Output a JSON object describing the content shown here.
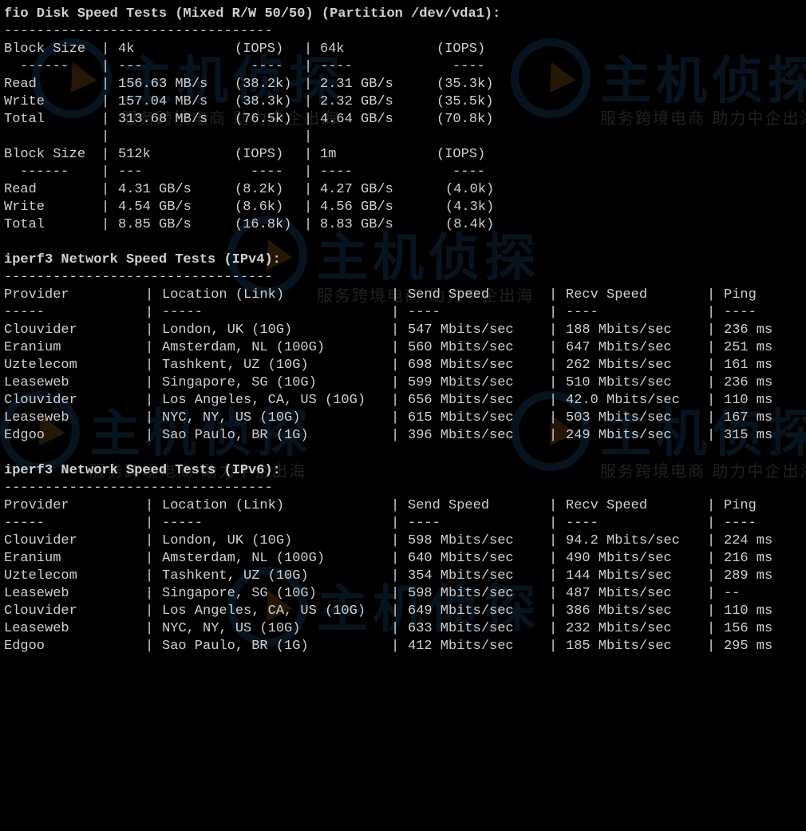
{
  "fio": {
    "title": "fio Disk Speed Tests (Mixed R/W 50/50) (Partition /dev/vda1):",
    "rule": "---------------------------------",
    "table1": {
      "header": {
        "label": "Block Size",
        "col1": "4k",
        "iops1": "(IOPS)",
        "col2": "64k",
        "iops2": "(IOPS)"
      },
      "sep": {
        "label": "------",
        "col1": "---",
        "iops1": "----",
        "col2": "----",
        "iops2": "----"
      },
      "rows": [
        {
          "label": "Read",
          "v1": "156.63 MB/s",
          "i1": "(38.2k)",
          "v2": "2.31 GB/s",
          "i2": "(35.3k)"
        },
        {
          "label": "Write",
          "v1": "157.04 MB/s",
          "i1": "(38.3k)",
          "v2": "2.32 GB/s",
          "i2": "(35.5k)"
        },
        {
          "label": "Total",
          "v1": "313.68 MB/s",
          "i1": "(76.5k)",
          "v2": "4.64 GB/s",
          "i2": "(70.8k)"
        }
      ]
    },
    "table2": {
      "header": {
        "label": "Block Size",
        "col1": "512k",
        "iops1": "(IOPS)",
        "col2": "1m",
        "iops2": "(IOPS)"
      },
      "sep": {
        "label": "------",
        "col1": "---",
        "iops1": "----",
        "col2": "----",
        "iops2": "----"
      },
      "rows": [
        {
          "label": "Read",
          "v1": "4.31 GB/s",
          "i1": "(8.2k)",
          "v2": "4.27 GB/s",
          "i2": "(4.0k)"
        },
        {
          "label": "Write",
          "v1": "4.54 GB/s",
          "i1": "(8.6k)",
          "v2": "4.56 GB/s",
          "i2": "(4.3k)"
        },
        {
          "label": "Total",
          "v1": "8.85 GB/s",
          "i1": "(16.8k)",
          "v2": "8.83 GB/s",
          "i2": "(8.4k)"
        }
      ]
    }
  },
  "iperf4": {
    "title": "iperf3 Network Speed Tests (IPv4):",
    "rule": "---------------------------------",
    "header": {
      "provider": "Provider",
      "location": "Location (Link)",
      "send": "Send Speed",
      "recv": "Recv Speed",
      "ping": "Ping"
    },
    "sep": {
      "provider": "-----",
      "location": "-----",
      "send": "----",
      "recv": "----",
      "ping": "----"
    },
    "rows": [
      {
        "provider": "Clouvider",
        "location": "London, UK (10G)",
        "send": "547 Mbits/sec",
        "recv": "188 Mbits/sec",
        "ping": "236 ms"
      },
      {
        "provider": "Eranium",
        "location": "Amsterdam, NL (100G)",
        "send": "560 Mbits/sec",
        "recv": "647 Mbits/sec",
        "ping": "251 ms"
      },
      {
        "provider": "Uztelecom",
        "location": "Tashkent, UZ (10G)",
        "send": "698 Mbits/sec",
        "recv": "262 Mbits/sec",
        "ping": "161 ms"
      },
      {
        "provider": "Leaseweb",
        "location": "Singapore, SG (10G)",
        "send": "599 Mbits/sec",
        "recv": "510 Mbits/sec",
        "ping": "236 ms"
      },
      {
        "provider": "Clouvider",
        "location": "Los Angeles, CA, US (10G)",
        "send": "656 Mbits/sec",
        "recv": "42.0 Mbits/sec",
        "ping": "110 ms"
      },
      {
        "provider": "Leaseweb",
        "location": "NYC, NY, US (10G)",
        "send": "615 Mbits/sec",
        "recv": "503 Mbits/sec",
        "ping": "167 ms"
      },
      {
        "provider": "Edgoo",
        "location": "Sao Paulo, BR (1G)",
        "send": "396 Mbits/sec",
        "recv": "249 Mbits/sec",
        "ping": "315 ms"
      }
    ]
  },
  "iperf6": {
    "title": "iperf3 Network Speed Tests (IPv6):",
    "rule": "---------------------------------",
    "header": {
      "provider": "Provider",
      "location": "Location (Link)",
      "send": "Send Speed",
      "recv": "Recv Speed",
      "ping": "Ping"
    },
    "sep": {
      "provider": "-----",
      "location": "-----",
      "send": "----",
      "recv": "----",
      "ping": "----"
    },
    "rows": [
      {
        "provider": "Clouvider",
        "location": "London, UK (10G)",
        "send": "598 Mbits/sec",
        "recv": "94.2 Mbits/sec",
        "ping": "224 ms"
      },
      {
        "provider": "Eranium",
        "location": "Amsterdam, NL (100G)",
        "send": "640 Mbits/sec",
        "recv": "490 Mbits/sec",
        "ping": "216 ms"
      },
      {
        "provider": "Uztelecom",
        "location": "Tashkent, UZ (10G)",
        "send": "354 Mbits/sec",
        "recv": "144 Mbits/sec",
        "ping": "289 ms"
      },
      {
        "provider": "Leaseweb",
        "location": "Singapore, SG (10G)",
        "send": "598 Mbits/sec",
        "recv": "487 Mbits/sec",
        "ping": "--"
      },
      {
        "provider": "Clouvider",
        "location": "Los Angeles, CA, US (10G)",
        "send": "649 Mbits/sec",
        "recv": "386 Mbits/sec",
        "ping": "110 ms"
      },
      {
        "provider": "Leaseweb",
        "location": "NYC, NY, US (10G)",
        "send": "633 Mbits/sec",
        "recv": "232 Mbits/sec",
        "ping": "156 ms"
      },
      {
        "provider": "Edgoo",
        "location": "Sao Paulo, BR (1G)",
        "send": "412 Mbits/sec",
        "recv": "185 Mbits/sec",
        "ping": "295 ms"
      }
    ]
  },
  "watermark": {
    "title": "主机侦探",
    "subtitle": "服务跨境电商 助力中企出海",
    "accent": "#2a6fb0",
    "logo_accent": "#d07a1e"
  },
  "colors": {
    "background": "#000000",
    "text": "#d0d0d0"
  }
}
